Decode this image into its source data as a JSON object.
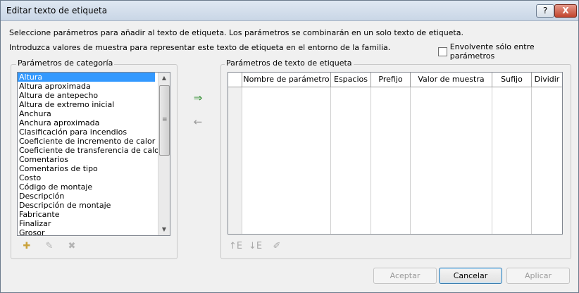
{
  "window": {
    "title": "Editar texto de etiqueta"
  },
  "titlebar": {
    "help_label": "?",
    "close_label": "X"
  },
  "intro": {
    "line1": "Seleccione parámetros para añadir al texto de etiqueta. Los parámetros se combinarán en un solo texto de etiqueta.",
    "line2": "Introduzca valores de muestra para representar este texto de etiqueta en el entorno de la familia."
  },
  "wrap_option": {
    "label": "Envolvente sólo entre parámetros",
    "checked": false
  },
  "category_params": {
    "title": "Parámetros de categoría",
    "items": [
      "Altura",
      "Altura aproximada",
      "Altura de antepecho",
      "Altura de extremo inicial",
      "Anchura",
      "Anchura aproximada",
      "Clasificación para incendios",
      "Coeficiente de incremento de calor solar",
      "Coeficiente de transferencia de calor (U)",
      "Comentarios",
      "Comentarios de tipo",
      "Costo",
      "Código de montaje",
      "Descripción",
      "Descripción de montaje",
      "Fabricante",
      "Finalizar",
      "Grosor"
    ],
    "selected_index": 0
  },
  "label_params": {
    "title": "Parámetros de texto de etiqueta",
    "columns": [
      "Nombre de parámetro",
      "Espacios",
      "Prefijo",
      "Valor de muestra",
      "Sufijo",
      "Dividir"
    ]
  },
  "icons": {
    "add": "add-parameter-icon",
    "remove": "remove-parameter-icon",
    "new_param": "new-parameter-icon",
    "edit_param": "edit-parameter-icon",
    "delete_param": "delete-parameter-icon",
    "move_up": "move-up-icon",
    "move_down": "move-down-icon",
    "format": "edit-format-icon"
  },
  "buttons": {
    "accept": "Aceptar",
    "cancel": "Cancelar",
    "apply": "Aplicar"
  }
}
